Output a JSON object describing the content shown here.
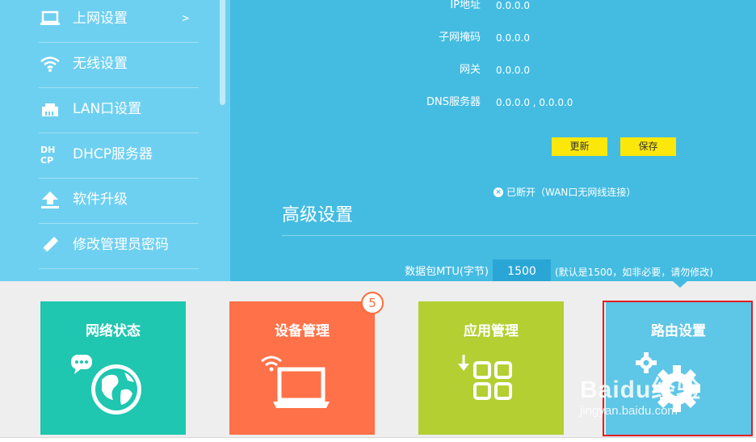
{
  "sidebar": {
    "items": [
      {
        "label": "上网设置",
        "icon": "laptop-icon",
        "arrow": ">"
      },
      {
        "label": "无线设置",
        "icon": "wifi-icon"
      },
      {
        "label": "LAN口设置",
        "icon": "lan-port-icon"
      },
      {
        "label": "DHCP服务器",
        "icon": "dhcp-icon"
      },
      {
        "label": "软件升级",
        "icon": "upload-icon"
      },
      {
        "label": "修改管理员密码",
        "icon": "pencil-icon"
      }
    ]
  },
  "wan": {
    "fields": [
      {
        "label": "IP地址",
        "value": "0.0.0.0"
      },
      {
        "label": "子网掩码",
        "value": "0.0.0.0"
      },
      {
        "label": "网关",
        "value": "0.0.0.0"
      },
      {
        "label": "DNS服务器",
        "value": "0.0.0.0 , 0.0.0.0"
      }
    ],
    "refresh_label": "更新",
    "save_label": "保存",
    "status_icon": "×",
    "status_text": "已断开（WAN口无网线连接）"
  },
  "advanced": {
    "title": "高级设置",
    "mtu_label": "数据包MTU(字节)",
    "mtu_value": "1500",
    "mtu_hint": "(默认是1500，如非必要，请勿修改)"
  },
  "tiles": [
    {
      "title": "网络状态",
      "color": "#1fc6b0",
      "icon": "globe-chat-icon"
    },
    {
      "title": "设备管理",
      "color": "#ff7148",
      "icon": "laptop-wifi-icon",
      "badge": "5"
    },
    {
      "title": "应用管理",
      "color": "#b3cf32",
      "icon": "apps-grid-icon"
    },
    {
      "title": "路由设置",
      "color": "#5ec6e6",
      "icon": "gears-icon"
    }
  ],
  "watermark": {
    "logo": "Baidu经验",
    "url": "jingyan.baidu.com"
  },
  "colors": {
    "sidebar": "#6ed0f1",
    "content": "#44bce2",
    "button": "#fbe80a",
    "highlight": "#e51c23"
  }
}
